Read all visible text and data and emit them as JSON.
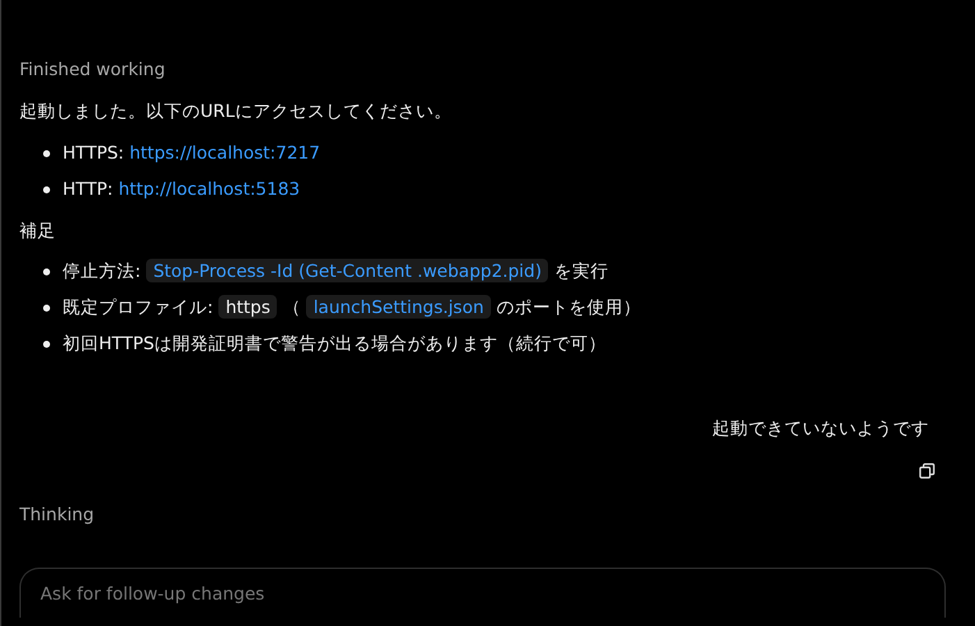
{
  "status": "Finished working",
  "intro": "起動しました。以下のURLにアクセスしてください。",
  "urls": [
    {
      "segments": [
        {
          "kind": "text",
          "text": "HTTPS: "
        },
        {
          "kind": "link",
          "text": "https://localhost:7217"
        }
      ]
    },
    {
      "segments": [
        {
          "kind": "text",
          "text": "HTTP: "
        },
        {
          "kind": "link",
          "text": "http://localhost:5183"
        }
      ]
    }
  ],
  "heading": "補足",
  "notes": [
    {
      "segments": [
        {
          "kind": "text",
          "text": "停止方法: "
        },
        {
          "kind": "code-link",
          "text": "Stop-Process -Id (Get-Content .webapp2.pid)"
        },
        {
          "kind": "text",
          "text": " を実行"
        }
      ]
    },
    {
      "segments": [
        {
          "kind": "text",
          "text": "既定プロファイル: "
        },
        {
          "kind": "code",
          "text": "https"
        },
        {
          "kind": "text",
          "text": " （ "
        },
        {
          "kind": "code-link",
          "text": "launchSettings.json"
        },
        {
          "kind": "text",
          "text": " のポートを使用）"
        }
      ]
    },
    {
      "segments": [
        {
          "kind": "text",
          "text": "初回HTTPSは開発証明書で警告が出る場合があります（続行で可）"
        }
      ]
    }
  ],
  "user_message": "起動できていないようです",
  "thinking": "Thinking",
  "composer": {
    "placeholder": "Ask for follow-up changes"
  }
}
